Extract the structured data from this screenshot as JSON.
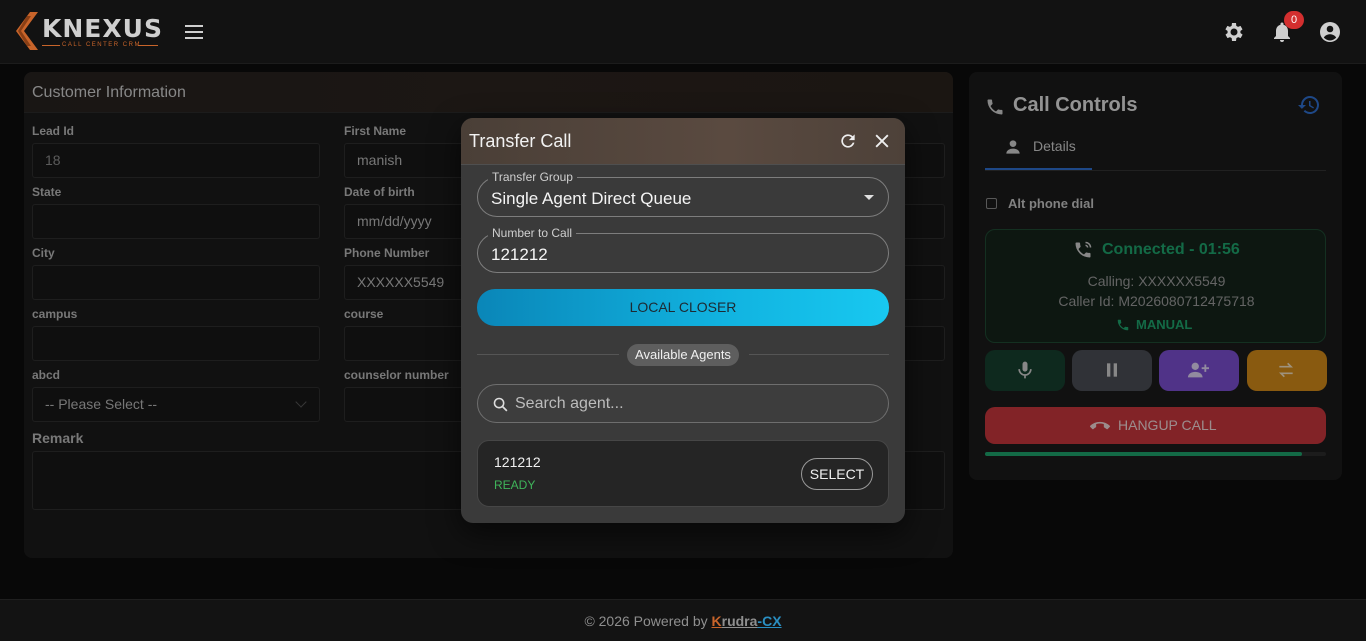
{
  "header": {
    "logo_text": "KNEXUS",
    "logo_subtext": "CALL CENTER CRM",
    "notification_count": "0",
    "icons": [
      "menu-icon",
      "gear-icon",
      "bell-icon",
      "account-circle-icon"
    ]
  },
  "customer_info": {
    "title": "Customer Information",
    "fields": {
      "lead_id": {
        "label": "Lead Id",
        "value": "18"
      },
      "first_name": {
        "label": "First Name",
        "value": "manish"
      },
      "state": {
        "label": "State",
        "value": ""
      },
      "dob": {
        "label": "Date of birth",
        "placeholder": "mm/dd/yyyy"
      },
      "city": {
        "label": "City",
        "value": ""
      },
      "phone": {
        "label": "Phone Number",
        "value": "XXXXXX5549"
      },
      "campus": {
        "label": "campus",
        "value": ""
      },
      "course": {
        "label": "course",
        "value": ""
      },
      "abcd": {
        "label": "abcd",
        "selected": "-- Please Select --"
      },
      "counselor": {
        "label": "counselor number",
        "value": ""
      },
      "remark": {
        "label": "Remark",
        "value": ""
      }
    }
  },
  "call_controls": {
    "title": "Call Controls",
    "tab_details": "Details",
    "alt_phone_label": "Alt phone dial",
    "alt_phone_checked": false,
    "status": "Connected - 01:56",
    "calling": "Calling: XXXXXX5549",
    "caller_id": "Caller Id: M2026080712475718",
    "mode": "MANUAL",
    "hangup_label": "HANGUP CALL",
    "call_progress": 0.93,
    "colors": {
      "connected": "#1ea36c",
      "hangup": "#c8363d",
      "mute": "#16402f",
      "hold": "#4a4d55",
      "add": "#7b4fd1",
      "transfer": "#d38a1a"
    }
  },
  "transfer_dialog": {
    "title": "Transfer Call",
    "group_label": "Transfer Group",
    "group_value": "Single Agent Direct Queue",
    "number_label": "Number to Call",
    "number_value": "121212",
    "local_closer_label": "LOCAL CLOSER",
    "available_agents_label": "Available Agents",
    "search_placeholder": "Search agent...",
    "agents": [
      {
        "number": "121212",
        "status": "READY",
        "action": "SELECT"
      }
    ]
  },
  "footer": {
    "text": "© 2026 Powered by",
    "brand_part1": "K",
    "brand_part2": "rudra",
    "brand_part3": "-CX"
  }
}
